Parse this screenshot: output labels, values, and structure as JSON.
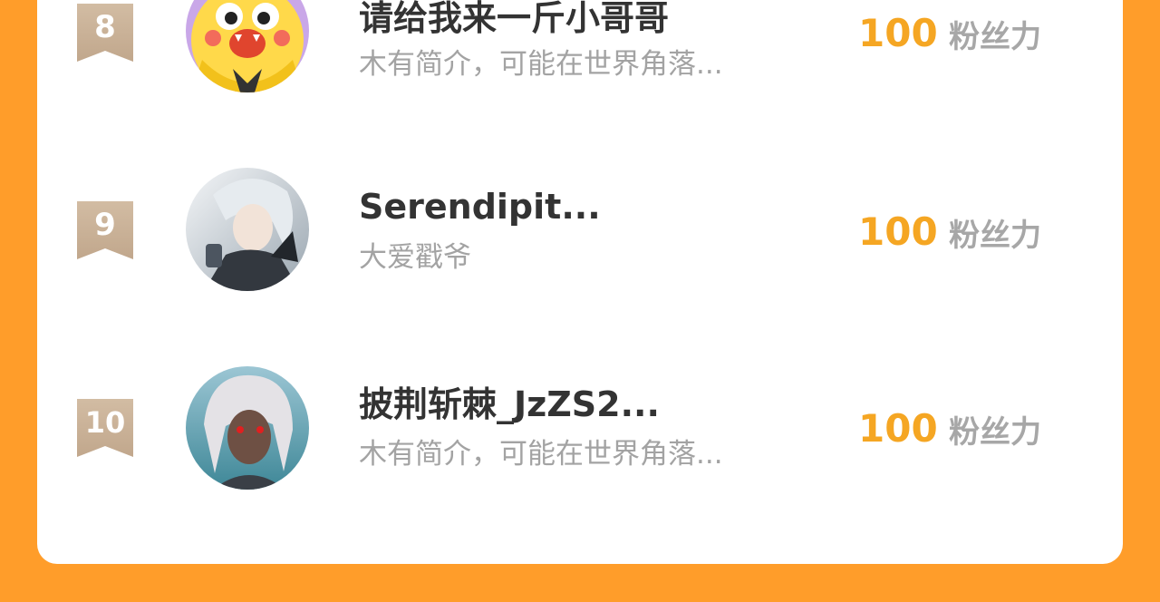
{
  "list": {
    "unit_label": "粉丝力",
    "rows": [
      {
        "rank": "8",
        "name": "请给我来一斤小哥哥",
        "bio": "木有简介，可能在世界角落...",
        "score": "100",
        "avatar": "cartoon-duck-avatar"
      },
      {
        "rank": "9",
        "name": "Serendipit...",
        "bio": "大爱戳爷",
        "score": "100",
        "avatar": "anime-white-hair-avatar"
      },
      {
        "rank": "10",
        "name": "披荆斩棘_JzZS2...",
        "bio": "木有简介，可能在世界角落...",
        "score": "100",
        "avatar": "anime-red-eyes-avatar"
      }
    ]
  },
  "colors": {
    "background": "#FF9D2A",
    "card": "#FFFFFF",
    "rank_badge": "#C9B29A",
    "score": "#F5A623",
    "name": "#333333",
    "bio": "#A3A3A3",
    "unit": "#A7A7A7"
  }
}
